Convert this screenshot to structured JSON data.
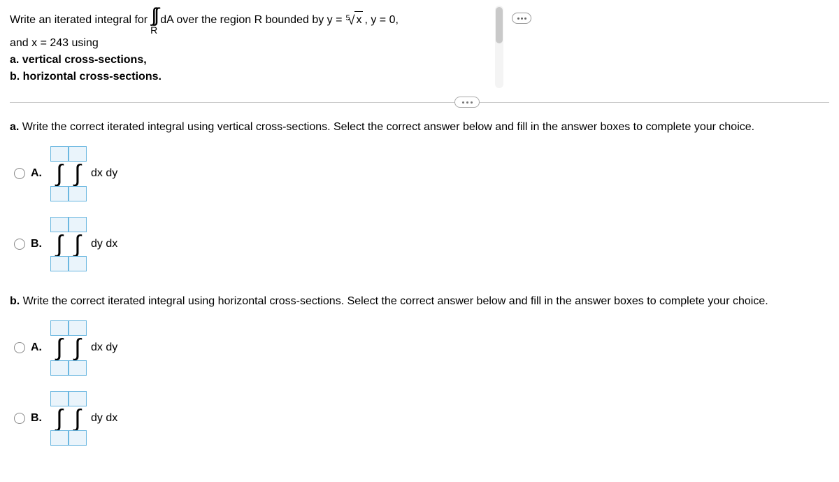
{
  "question": {
    "line1_part1": "Write an iterated integral for",
    "integral_sub": "R",
    "line1_part2": "dA over the region R bounded by y =",
    "root_index": "5",
    "root_body": "x",
    "line1_part3": ", y = 0,",
    "line2": "and x = 243 using",
    "line3": "a. vertical cross-sections,",
    "line4": "b. horizontal cross-sections."
  },
  "part_a": {
    "prompt_prefix": "a.",
    "prompt": "Write the correct iterated integral using vertical cross-sections. Select the correct answer below and fill in the answer boxes to complete your choice.",
    "options": {
      "A": {
        "label": "A.",
        "diff": "dx dy"
      },
      "B": {
        "label": "B.",
        "diff": "dy dx"
      }
    }
  },
  "part_b": {
    "prompt_prefix": "b.",
    "prompt": "Write the correct iterated integral using horizontal cross-sections. Select the correct answer below and fill in the answer boxes to complete your choice.",
    "options": {
      "A": {
        "label": "A.",
        "diff": "dx dy"
      },
      "B": {
        "label": "B.",
        "diff": "dy dx"
      }
    }
  },
  "chart_data": {
    "type": "table",
    "description": "Math homework multiple-choice question about iterated integrals",
    "region": {
      "upper_curve": "y = x^(1/5)",
      "lower": "y = 0",
      "right": "x = 243"
    },
    "parts": [
      {
        "id": "a",
        "task": "vertical cross-sections",
        "choices": [
          "∫∫ dx dy",
          "∫∫ dy dx"
        ]
      },
      {
        "id": "b",
        "task": "horizontal cross-sections",
        "choices": [
          "∫∫ dx dy",
          "∫∫ dy dx"
        ]
      }
    ]
  }
}
